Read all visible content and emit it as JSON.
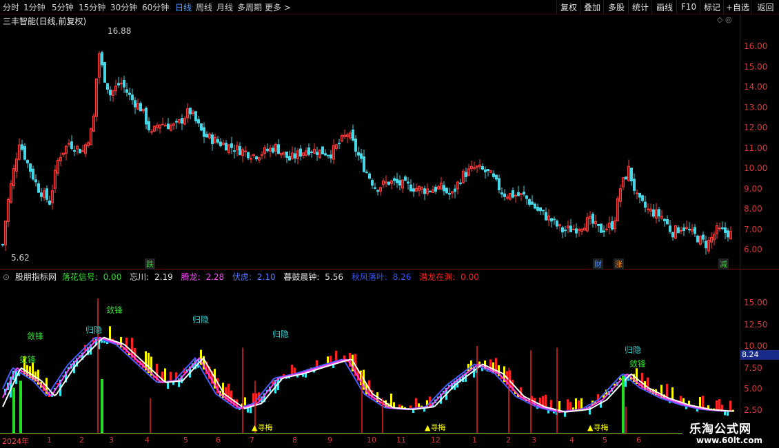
{
  "toolbar": {
    "periods": [
      "分时",
      "1分钟",
      "5分钟",
      "15分钟",
      "30分钟",
      "60分钟",
      "日线",
      "周线",
      "月线",
      "多周期",
      "更多 >"
    ],
    "active_period": "日线",
    "buttons": [
      "复权",
      "叠加",
      "多股",
      "统计",
      "画线",
      "F10",
      "标记",
      "+自选",
      "返回"
    ]
  },
  "main_chart": {
    "title": "三丰智能(日线,前复权)",
    "high_label": "16.88",
    "low_label": "5.62",
    "y_ticks": [
      "16.00",
      "15.00",
      "14.00",
      "13.00",
      "12.00",
      "11.00",
      "10.00",
      "9.00",
      "8.00",
      "7.00",
      "6.00"
    ],
    "markers": [
      {
        "text": "跌",
        "color": "#33cc33"
      },
      {
        "text": "财",
        "color": "#4a90ff"
      },
      {
        "text": "涨",
        "color": "#ff8800"
      },
      {
        "text": "减",
        "color": "#33cc33"
      }
    ]
  },
  "indicator": {
    "name": "股朋指标网",
    "fields": [
      {
        "label": "落花信号:",
        "value": "0.00",
        "color": "#33dd33"
      },
      {
        "label": "忘川:",
        "value": "2.19",
        "color": "#e0e0e0"
      },
      {
        "label": "腾龙:",
        "value": "2.28",
        "color": "#ff44ff"
      },
      {
        "label": "伏虎:",
        "value": "2.10",
        "color": "#5577ff"
      },
      {
        "label": "暮鼓晨钟:",
        "value": "5.56",
        "color": "#e0e0e0"
      },
      {
        "label": "秋风落叶:",
        "value": "8.26",
        "color": "#3355ff"
      },
      {
        "label": "潜龙在渊:",
        "value": "0.00",
        "color": "#ff2222"
      }
    ],
    "y_ticks": [
      "15.00",
      "12.50",
      "10.00",
      "7.50",
      "5.00",
      "2.50"
    ],
    "current_value": "8.24",
    "signals": [
      {
        "text": "敛锋",
        "color": "#33dd33"
      },
      {
        "text": "敛锋",
        "color": "#33dd33"
      },
      {
        "text": "敛锋",
        "color": "#33dd33"
      },
      {
        "text": "归隐",
        "color": "#33cccc"
      },
      {
        "text": "归隐",
        "color": "#33cccc"
      },
      {
        "text": "归隐",
        "color": "#33cccc"
      },
      {
        "text": "归隐",
        "color": "#33cccc"
      },
      {
        "text": "敛锋",
        "color": "#33dd33"
      },
      {
        "text": "▲寻梅",
        "color": "#ffff00"
      },
      {
        "text": "▲寻梅",
        "color": "#ffff00"
      },
      {
        "text": "▲寻梅",
        "color": "#ffff00"
      }
    ]
  },
  "dates": [
    "2024年",
    "1",
    "2",
    "3",
    "4",
    "5",
    "6",
    "7",
    "8",
    "9",
    "10",
    "11",
    "12",
    "1",
    "2",
    "3",
    "4",
    "5",
    "6"
  ],
  "watermark": {
    "title": "乐淘公式网",
    "url": "www.60lt.com"
  }
}
